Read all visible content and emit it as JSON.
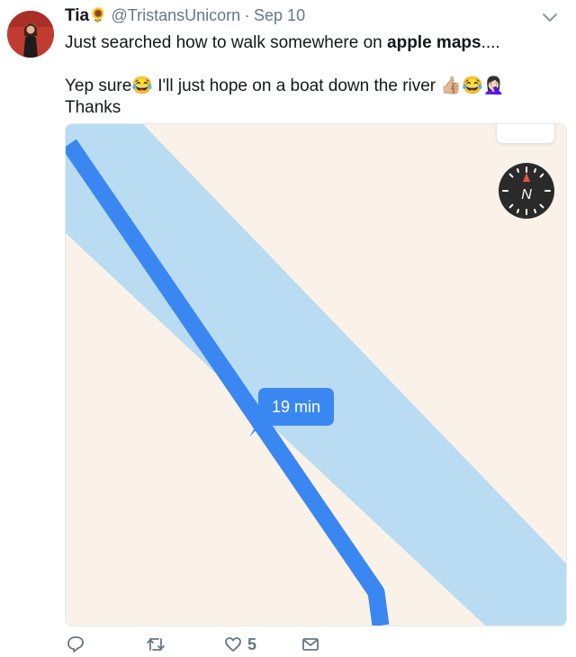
{
  "tweet": {
    "display_name": "Tia",
    "name_emoji": "🌻",
    "handle": "@TristansUnicorn",
    "separator": "·",
    "date": "Sep 10",
    "line1_prefix": "Just searched how to walk somewhere on ",
    "line1_bold": "apple maps",
    "line1_suffix": "....",
    "line2_a": "Yep sure",
    "line2_emoji_1": "😂",
    "line2_b": " I'll just hope on a boat down the river ",
    "line2_emoji_2": "👍🏼😂🤦🏻‍♀️",
    "line3": "Thanks"
  },
  "map": {
    "eta_label": "19 min",
    "compass_letter": "N",
    "colors": {
      "land": "#faf2e8",
      "river": "#b9dcf3",
      "route": "#3b87f1",
      "compass_bg": "#2a2a2a",
      "compass_needle": "#e8533d"
    }
  },
  "actions": {
    "reply_icon": "reply-icon",
    "retweet_icon": "retweet-icon",
    "like_icon": "heart-icon",
    "like_count": "5",
    "message_icon": "envelope-icon"
  }
}
